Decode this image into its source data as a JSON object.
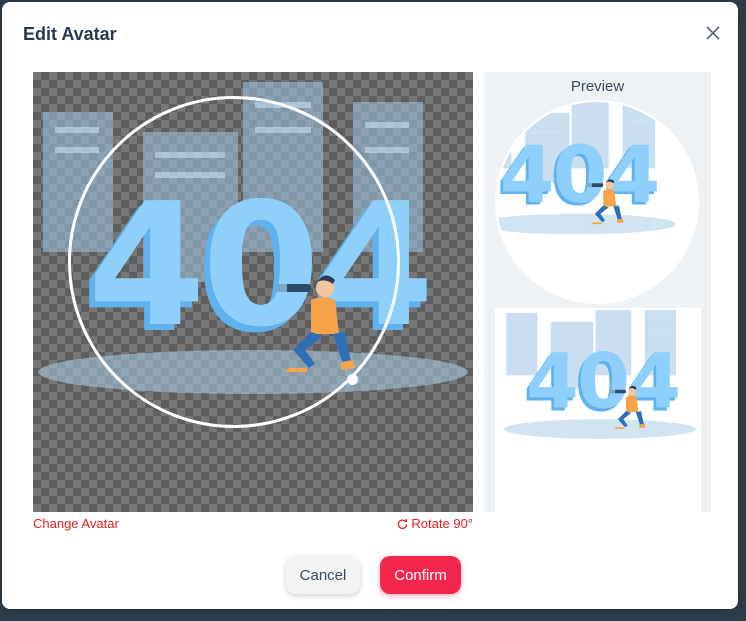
{
  "dialog": {
    "title": "Edit Avatar",
    "close_icon": "close-icon"
  },
  "cropper": {
    "image_text": "404"
  },
  "preview": {
    "label": "Preview"
  },
  "actions": {
    "change_avatar": "Change Avatar",
    "rotate_label": "Rotate 90°",
    "rotate_icon": "rotate-icon",
    "cancel": "Cancel",
    "confirm": "Confirm"
  },
  "colors": {
    "accent": "#f5264e",
    "link": "#e02020",
    "digit": "#7cc8f8"
  }
}
